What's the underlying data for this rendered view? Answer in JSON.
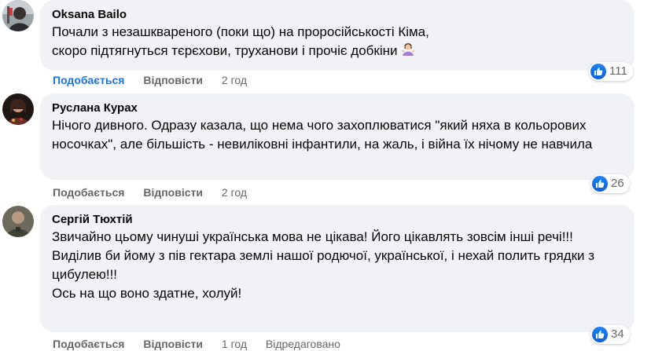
{
  "comments": [
    {
      "author": "Oksana Bailo",
      "lines": [
        "Почали з незашквареного (поки що) на проросійськості Кіма, скоро підтягнуться тєрєхови, труханови і прочіє добкіни"
      ],
      "emoji_icon": "woman-shrugging-emoji",
      "like_label": "Подобається",
      "reply_label": "Відповісти",
      "time": "2 год",
      "reaction_count": "111"
    },
    {
      "author": "Руслана Курах",
      "lines": [
        "Нічого дивного. Одразу казала, що нема чого захоплюватися \"який няха в кольорових носочках\", але більшість - невиліковні інфантили, на жаль, і війна їх нічому не навчила"
      ],
      "like_label": "Подобається",
      "reply_label": "Відповісти",
      "time": "2 год",
      "reaction_count": "26"
    },
    {
      "author": "Сергій Тюхтій",
      "lines": [
        "Звичайно цьому чинуші українська мова не цікава! Його цікавлять зовсім інші речі!!!",
        "Виділив би йому з пів гектара землі нашої родючої, української, і нехай полить грядки з цибулею!!!",
        "Ось на що воно здатне, холуй!"
      ],
      "like_label": "Подобається",
      "reply_label": "Відповісти",
      "time": "1 год",
      "edited_label": "Відредаговано",
      "reaction_count": "34"
    }
  ],
  "colors": {
    "bubble": "#f0f2f5",
    "like_active": "#1b74e4",
    "meta": "#65676b",
    "reaction_blue": "#1b86f5"
  }
}
